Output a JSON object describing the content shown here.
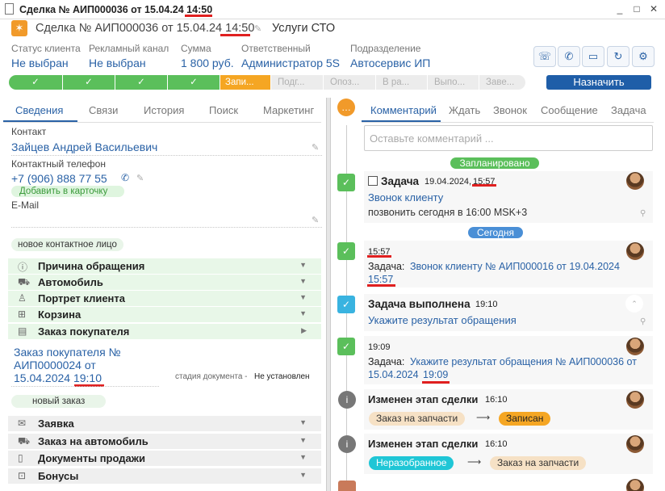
{
  "window": {
    "title": "Сделка № АИП000036 от 15.04.24 14:50",
    "controls": [
      "_",
      "□",
      "✕"
    ]
  },
  "header": {
    "deal_title": "Сделка № АИП000036 от 15.04.24 14:50",
    "service": "Услуги СТО",
    "fields": [
      {
        "label": "Статус клиента",
        "value": "Не выбран"
      },
      {
        "label": "Рекламный канал",
        "value": "Не выбран"
      },
      {
        "label": "Сумма",
        "value": "1 800 руб."
      },
      {
        "label": "Ответственный",
        "value": "Администратор 5S"
      },
      {
        "label": "Подразделение",
        "value": "Автосервис ИП"
      }
    ],
    "action_icons": [
      "call-transfer-icon",
      "phone-icon",
      "chat-icon",
      "refresh-icon",
      "gear-icon"
    ]
  },
  "stages": {
    "done_mark": "✓",
    "current": "Запи...",
    "todo": [
      "Подг...",
      "Опоз...",
      "В ра...",
      "Выпо...",
      "Заве..."
    ],
    "assign_label": "Назначить"
  },
  "left_tabs": [
    "Сведения",
    "Связи",
    "История",
    "Поиск",
    "Маркетинг"
  ],
  "contact": {
    "contact_label": "Контакт",
    "contact_value": "Зайцев Андрей Васильевич",
    "phone_label": "Контактный телефон",
    "phone_value": "+7 (906) 888 77 55",
    "add_to_card": "Добавить в карточку",
    "email_label": "E-Mail",
    "new_contact_tag": "новое контактное лицо"
  },
  "sections_green": [
    {
      "icon": "ⓘ",
      "icon_name": "info-icon",
      "label": "Причина обращения",
      "arrow": "▼"
    },
    {
      "icon": "⛟",
      "icon_name": "car-icon",
      "label": "Автомобиль",
      "arrow": "▼"
    },
    {
      "icon": "♙",
      "icon_name": "person-icon",
      "label": "Портрет клиента",
      "arrow": "▼"
    },
    {
      "icon": "⊞",
      "icon_name": "cart-icon",
      "label": "Корзина",
      "arrow": "▼"
    },
    {
      "icon": "▤",
      "icon_name": "order-icon",
      "label": "Заказ покупателя",
      "arrow": "▶"
    }
  ],
  "order": {
    "link": "Заказ покупателя № АИП0000024 от 15.04.2024 19:10",
    "doc_stage_label": "стадия документа -",
    "doc_stage_value": "Не установлен",
    "new_order_tag": "новый заказ"
  },
  "sections_gray": [
    {
      "icon": "✉",
      "icon_name": "envelope-icon",
      "label": "Заявка",
      "arrow": "▼"
    },
    {
      "icon": "⛟",
      "icon_name": "car-icon",
      "label": "Заказ на автомобиль",
      "arrow": "▼"
    },
    {
      "icon": "▯",
      "icon_name": "document-icon",
      "label": "Документы продажи",
      "arrow": "▼"
    },
    {
      "icon": "⊡",
      "icon_name": "gift-icon",
      "label": "Бонусы",
      "arrow": "▼"
    }
  ],
  "right_tabs": [
    "Комментарий",
    "Ждать",
    "Звонок",
    "Сообщение",
    "Задача"
  ],
  "comment_placeholder": "Оставьте комментарий ...",
  "timeline": {
    "planned_label": "Запланировано",
    "today_label": "Сегодня",
    "task1": {
      "title": "Задача",
      "date": "19.04.2024,",
      "time": "15:57",
      "link": "Звонок клиенту",
      "text": "позвонить сегодня в 16:00 MSK+3"
    },
    "task2": {
      "time": "15:57",
      "prefix": "Задача:",
      "link": "Звонок клиенту № АИП000016 от 19.04.2024",
      "link_time": "15:57"
    },
    "done": {
      "title": "Задача выполнена",
      "time": "19:10",
      "link": "Укажите результат обращения"
    },
    "task3": {
      "time": "19:09",
      "prefix": "Задача:",
      "link": "Укажите результат обращения № АИП000036 от",
      "link2": "15.04.2024",
      "link_time": "19:09"
    },
    "stage1": {
      "title": "Изменен этап сделки",
      "time": "16:10",
      "from": "Заказ на запчасти",
      "arrow": "⟶",
      "to": "Записан"
    },
    "stage2": {
      "title": "Изменен этап сделки",
      "time": "16:10",
      "from": "Неразобранное",
      "arrow": "⟶",
      "to": "Заказ на запчасти"
    }
  }
}
